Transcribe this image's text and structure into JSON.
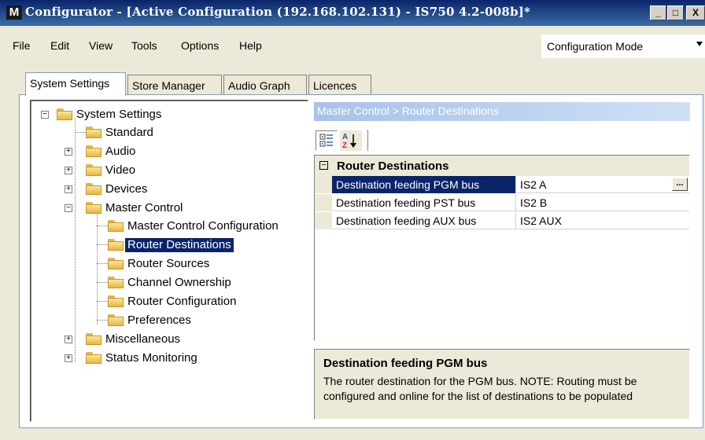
{
  "window": {
    "app_icon": "M",
    "title": "Configurator - [Active Configuration (192.168.102.131) - IS750 4.2-008b]*",
    "min_symbol": "_",
    "max_symbol": "□",
    "close_symbol": "X"
  },
  "menu": {
    "file": "File",
    "edit": "Edit",
    "view": "View",
    "tools": "Tools",
    "options": "Options",
    "help": "Help"
  },
  "mode": {
    "value": "Configuration Mode"
  },
  "tabs": {
    "system_settings": "System Settings",
    "store_manager": "Store Manager",
    "audio_graph": "Audio Graph",
    "licences": "Licences"
  },
  "tree": {
    "root": "System Settings",
    "standard": "Standard",
    "audio": "Audio",
    "video": "Video",
    "devices": "Devices",
    "master_control": "Master Control",
    "mc_configuration": "Master Control Configuration",
    "router_destinations": "Router Destinations",
    "router_sources": "Router Sources",
    "channel_ownership": "Channel Ownership",
    "router_configuration": "Router Configuration",
    "preferences": "Preferences",
    "miscellaneous": "Miscellaneous",
    "status_monitoring": "Status Monitoring",
    "expand_symbol": "+",
    "collapse_symbol": "−"
  },
  "breadcrumb": "Master Control > Router Destinations",
  "toolbar": {
    "categorized_icon": "categorized-icon",
    "alphabetical_icon": "sort-alphabetical-icon"
  },
  "properties": {
    "category": "Router Destinations",
    "collapse_symbol": "−",
    "rows": [
      {
        "name": "Destination feeding PGM bus",
        "value": "IS2 A"
      },
      {
        "name": "Destination feeding PST bus",
        "value": "IS2 B"
      },
      {
        "name": "Destination feeding AUX bus",
        "value": "IS2 AUX"
      }
    ],
    "ellipsis": "..."
  },
  "help": {
    "title": "Destination feeding PGM bus",
    "text": "The router destination for the PGM bus. NOTE: Routing must be configured and online for the list of destinations to be populated"
  },
  "colors": {
    "title_bar": "#0a246a",
    "selection": "#0a246a",
    "breadcrumb": "#a6c3e8",
    "panel_bg": "#ece9d8",
    "folder": "#f0c75a"
  }
}
